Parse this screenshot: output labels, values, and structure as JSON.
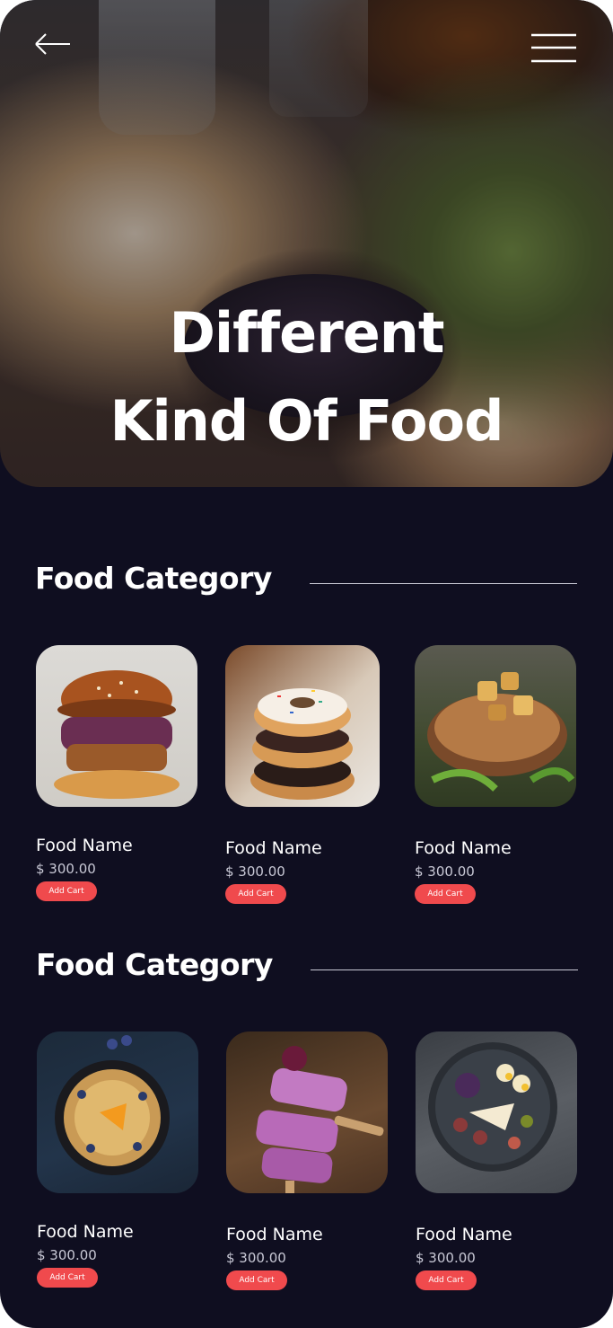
{
  "hero": {
    "title_line1": "Different",
    "title_line2": "Kind Of Food",
    "back_icon": "arrow-left-icon",
    "menu_icon": "hamburger-menu-icon"
  },
  "sections": [
    {
      "title": "Food Category",
      "items": [
        {
          "name": "Food Name",
          "price": "$ 300.00",
          "button": "Add Cart",
          "image": "burger"
        },
        {
          "name": "Food Name",
          "price": "$ 300.00",
          "button": "Add Cart",
          "image": "donuts"
        },
        {
          "name": "Food Name",
          "price": "$ 300.00",
          "button": "Add Cart",
          "image": "grilled-pork"
        }
      ]
    },
    {
      "title": "Food Category",
      "items": [
        {
          "name": "Food Name",
          "price": "$ 300.00",
          "button": "Add Cart",
          "image": "pancake"
        },
        {
          "name": "Food Name",
          "price": "$ 300.00",
          "button": "Add Cart",
          "image": "popsicles"
        },
        {
          "name": "Food Name",
          "price": "$ 300.00",
          "button": "Add Cart",
          "image": "cheese-platter"
        }
      ]
    }
  ],
  "colors": {
    "background": "#0f0e20",
    "accent": "#f04a4d",
    "text": "#ffffff",
    "muted": "#c9c9d6"
  }
}
